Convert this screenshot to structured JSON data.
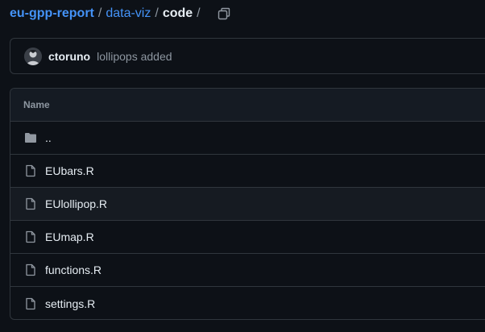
{
  "breadcrumb": {
    "repo": "eu-gpp-report",
    "folder": "data-viz",
    "current": "code",
    "separator": "/"
  },
  "commit": {
    "author": "ctoruno",
    "message": "lollipops added"
  },
  "table": {
    "header": "Name",
    "rows": [
      {
        "name": "..",
        "icon": "folder-icon"
      },
      {
        "name": "EUbars.R",
        "icon": "file-icon"
      },
      {
        "name": "EUlollipop.R",
        "icon": "file-icon"
      },
      {
        "name": "EUmap.R",
        "icon": "file-icon"
      },
      {
        "name": "functions.R",
        "icon": "file-icon"
      },
      {
        "name": "settings.R",
        "icon": "file-icon"
      }
    ]
  },
  "colors": {
    "background": "#0d1117",
    "link": "#4493f8",
    "border": "#30363d",
    "muted": "#8d96a0"
  }
}
